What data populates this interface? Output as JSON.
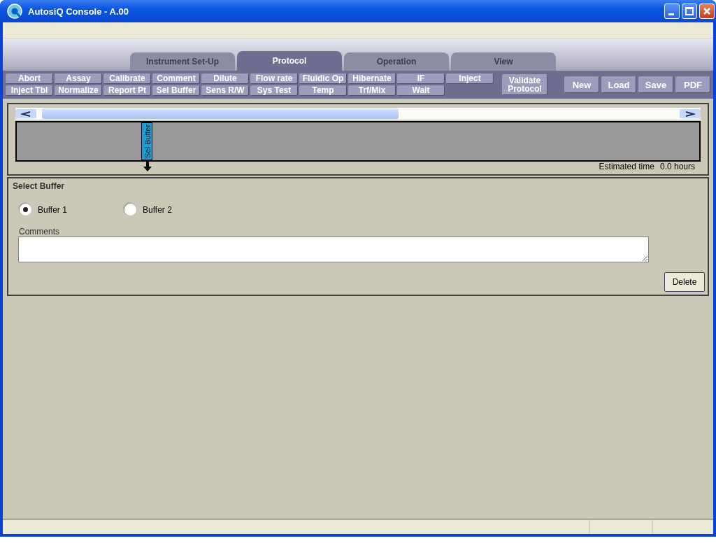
{
  "window": {
    "title": "AutosiQ Console - A.00"
  },
  "tabs": [
    {
      "label": "Instrument Set-Up",
      "selected": false
    },
    {
      "label": "Protocol",
      "selected": true
    },
    {
      "label": "Operation",
      "selected": false
    },
    {
      "label": "View",
      "selected": false
    }
  ],
  "step_buttons": [
    [
      "Abort",
      "Assay",
      "Calibrate",
      "Comment",
      "Dilute",
      "Flow rate",
      "Fluidic Op",
      "Hibernate",
      "IF",
      "Inject"
    ],
    [
      "Inject Tbl",
      "Normalize",
      "Report Pt",
      "Sel Buffer",
      "Sens R/W",
      "Sys Test",
      "Temp",
      "Trf/Mix",
      "Wait"
    ]
  ],
  "validate_button": "Validate Protocol",
  "file_buttons": [
    "New",
    "Load",
    "Save",
    "PDF"
  ],
  "timeline": {
    "steps": [
      {
        "label": "Sel Buffer",
        "selected": true
      }
    ],
    "estimated_time_label": "Estimated time",
    "estimated_time": "0.0 hours"
  },
  "detail": {
    "title": "Select Buffer",
    "options": [
      {
        "label": "Buffer 1",
        "selected": true
      },
      {
        "label": "Buffer 2",
        "selected": false
      }
    ],
    "comments_label": "Comments",
    "delete_button": "Delete"
  }
}
